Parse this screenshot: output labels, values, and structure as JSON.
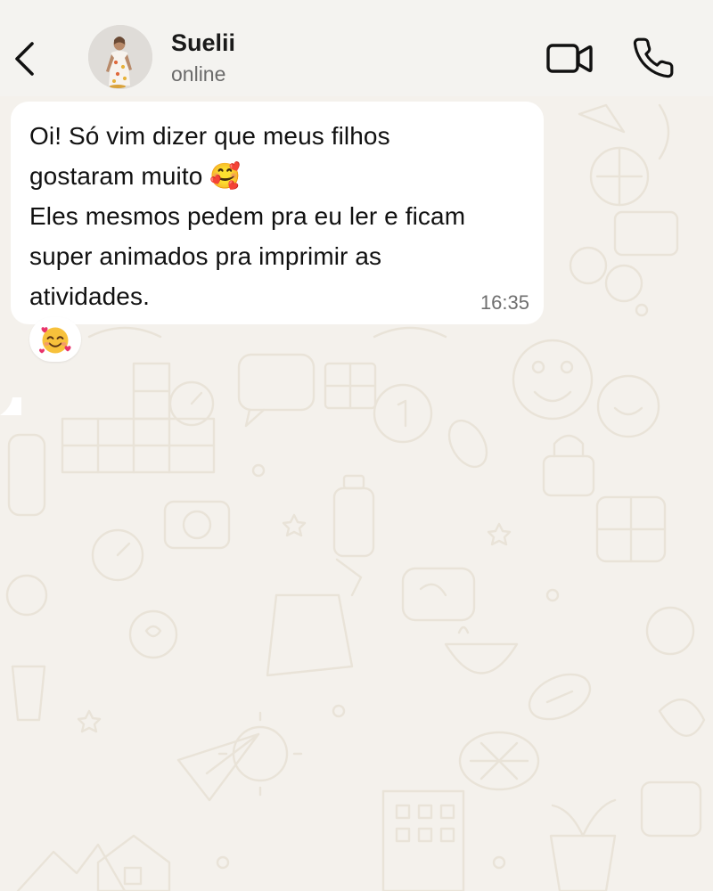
{
  "header": {
    "contact_name": "Suelii",
    "status": "online"
  },
  "messages": [
    {
      "text": "Oi! Só vim dizer que meus filhos\ngostaram muito 🥰\nEles mesmos pedem pra eu ler e ficam\nsuper animados pra imprimir as\natividades.",
      "time": "16:35",
      "reaction": "🥰"
    }
  ],
  "icons": {
    "back": "chevron-left-icon",
    "video": "video-camera-icon",
    "call": "phone-icon",
    "emoji": "smiling-face-with-hearts"
  },
  "colors": {
    "header_bg": "#f4f3f0",
    "chat_bg": "#f4f1ec",
    "bubble_bg": "#ffffff",
    "doodle": "#e9e3d8"
  }
}
